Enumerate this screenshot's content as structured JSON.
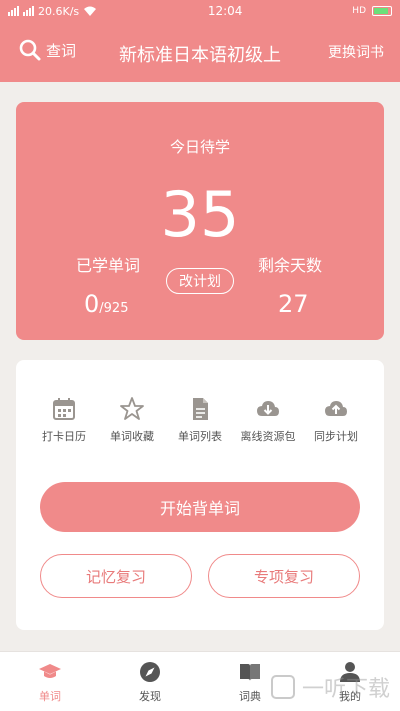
{
  "status": {
    "speed": "20.6K/s",
    "time": "12:04",
    "hd": "HD"
  },
  "header": {
    "search_label": "查词",
    "title": "新标准日本语初级上",
    "change_book": "更换词书"
  },
  "today": {
    "label": "今日待学",
    "count": "35",
    "learned_label": "已学单词",
    "learned_value": "0",
    "learned_total": "/925",
    "plan_button": "改计划",
    "days_label": "剩余天数",
    "days_value": "27"
  },
  "tools": [
    {
      "label": "打卡日历",
      "icon": "calendar-icon"
    },
    {
      "label": "单词收藏",
      "icon": "star-icon"
    },
    {
      "label": "单词列表",
      "icon": "document-icon"
    },
    {
      "label": "离线资源包",
      "icon": "cloud-download-icon"
    },
    {
      "label": "同步计划",
      "icon": "cloud-upload-icon"
    }
  ],
  "actions": {
    "start": "开始背单词",
    "memory_review": "记忆复习",
    "special_review": "专项复习"
  },
  "tabs": [
    {
      "label": "单词",
      "icon": "graduation-cap-icon"
    },
    {
      "label": "发现",
      "icon": "compass-icon"
    },
    {
      "label": "词典",
      "icon": "book-icon"
    },
    {
      "label": "我的",
      "icon": "person-icon"
    }
  ],
  "watermark": {
    "text": "一听下载"
  },
  "colors": {
    "accent": "#f08a8a",
    "background": "#f1eeeb",
    "icon_gray": "#9a9590"
  }
}
